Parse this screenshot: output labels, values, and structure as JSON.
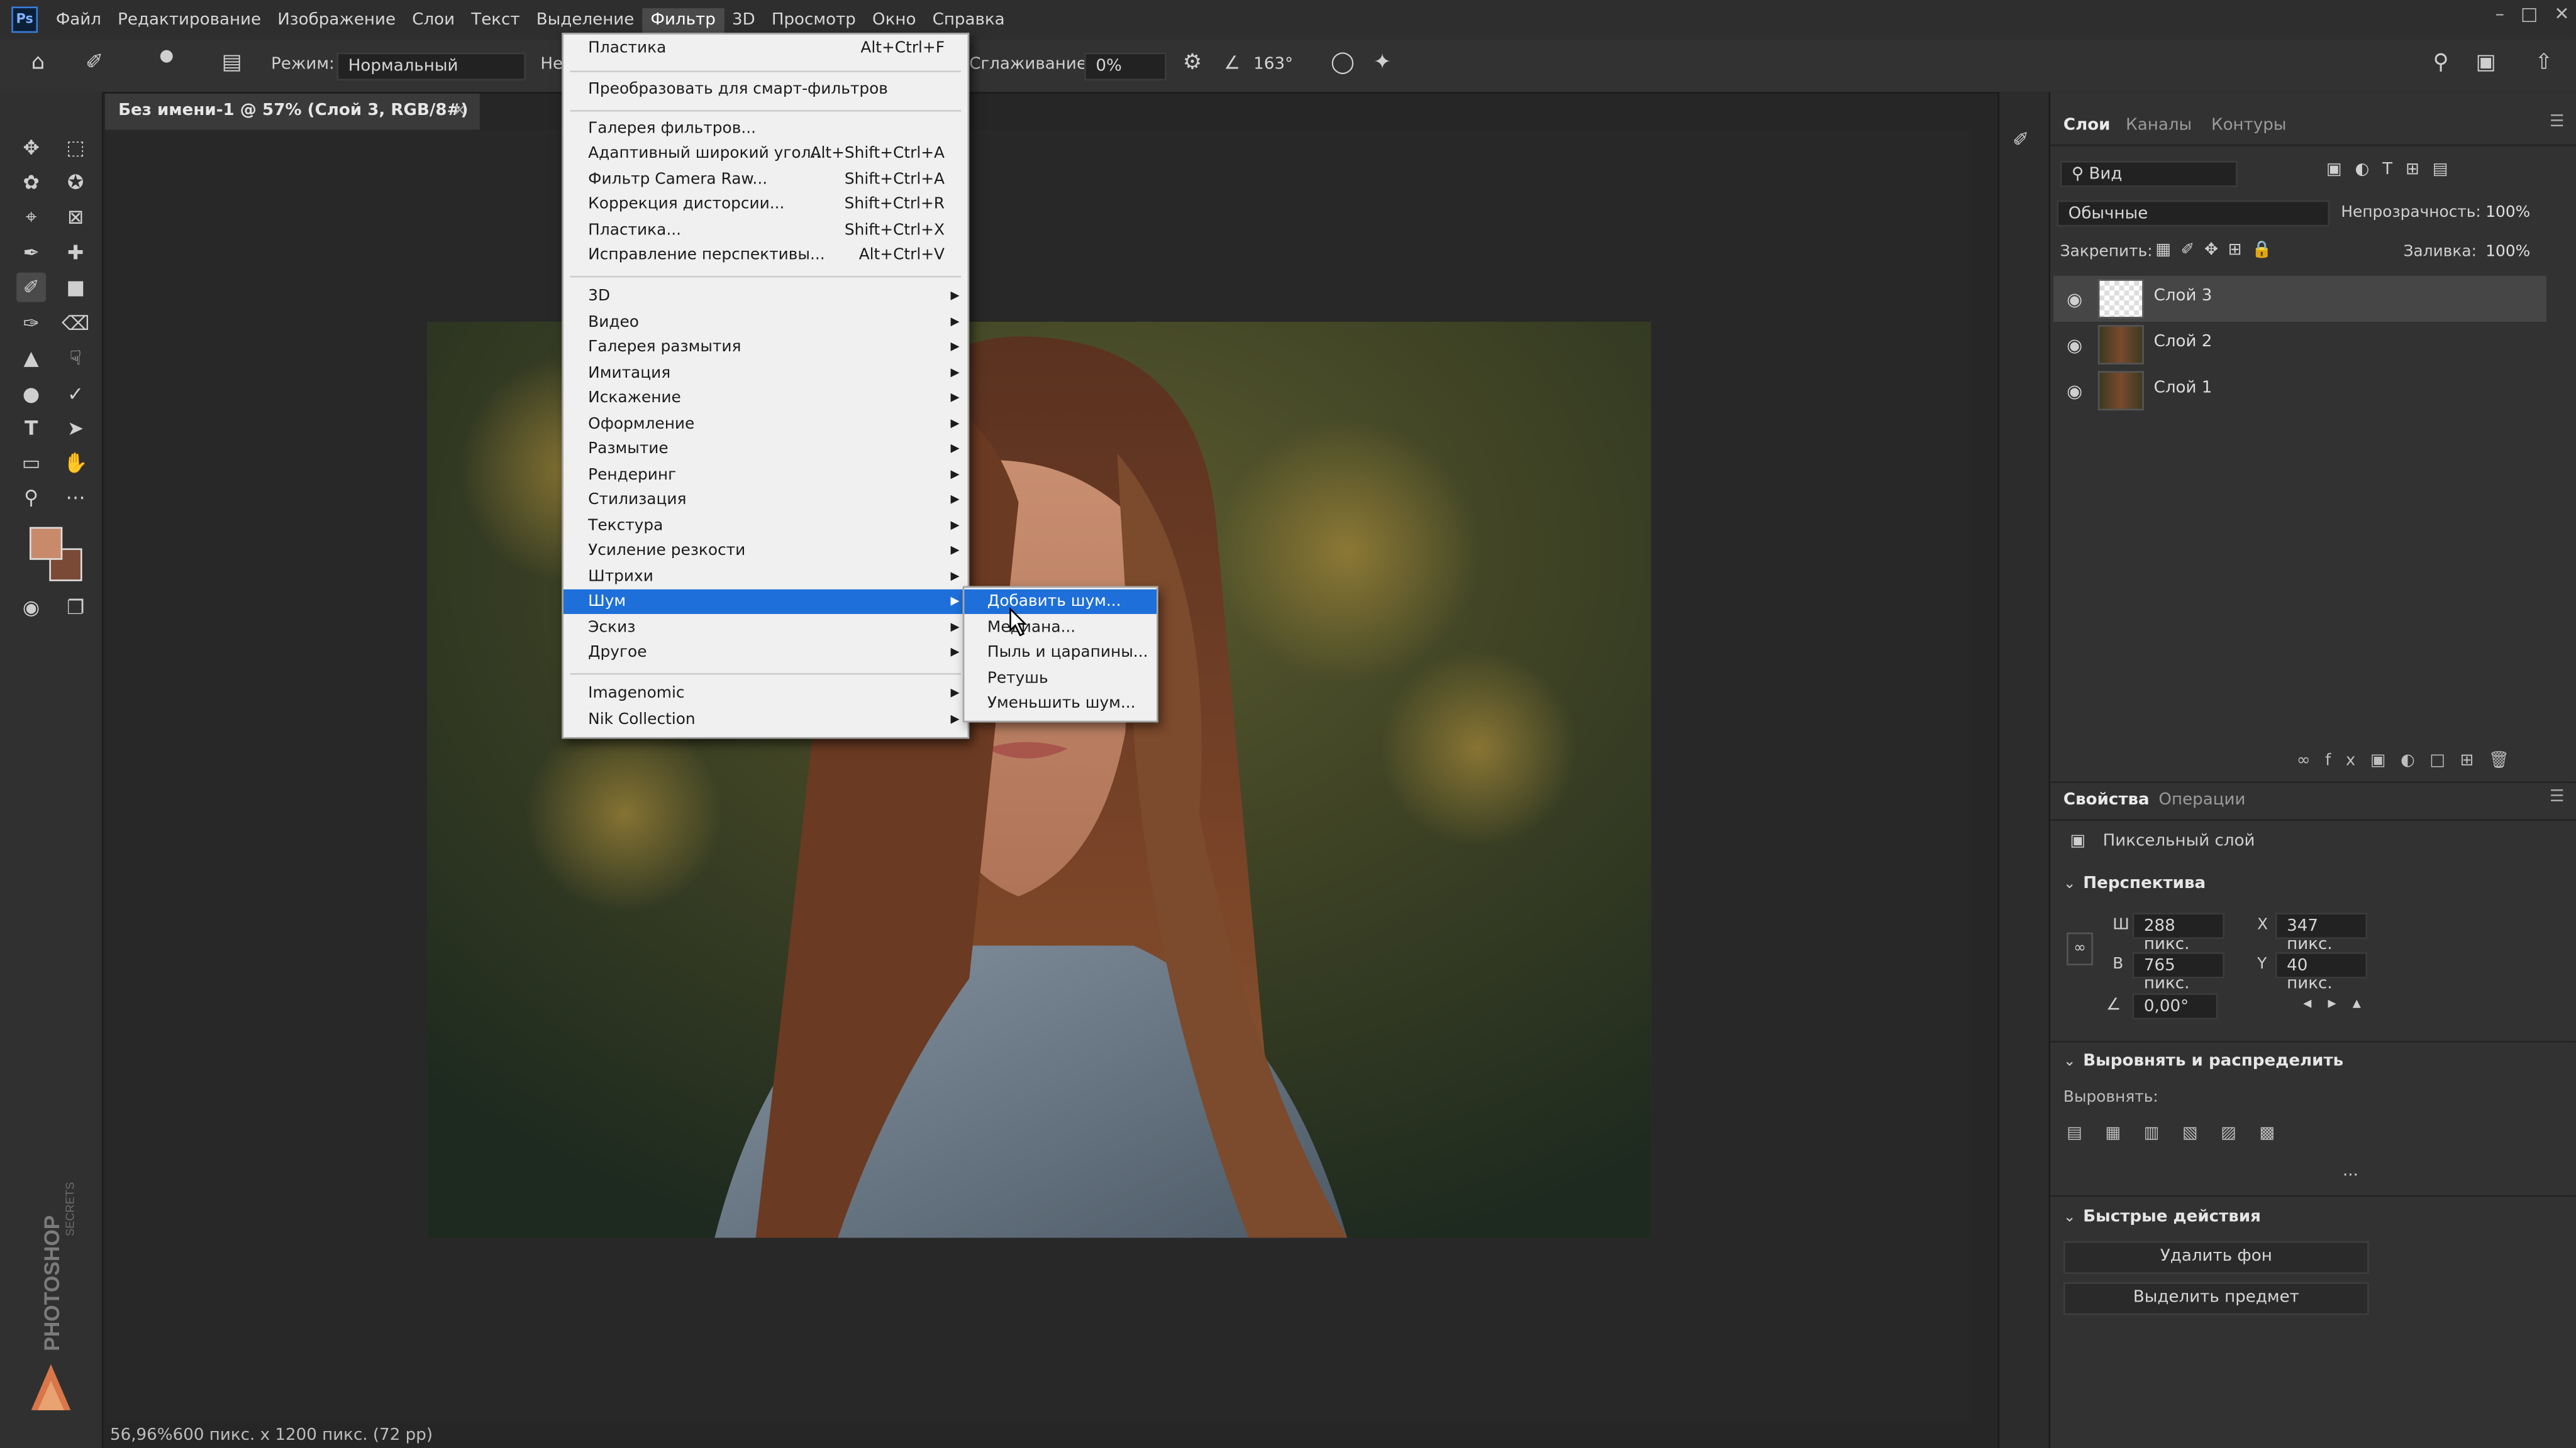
{
  "menubar": {
    "logo": "Ps",
    "items": [
      "Файл",
      "Редактирование",
      "Изображение",
      "Слои",
      "Текст",
      "Выделение",
      "Фильтр",
      "3D",
      "Просмотр",
      "Окно",
      "Справка"
    ],
    "active_index": 6
  },
  "options": {
    "mode_label": "Режим:",
    "mode_value": "Нормальный",
    "opacity_label_partial": "Не",
    "smoothing_label": "Сглаживание:",
    "smoothing_value": "0%",
    "angle_value": "163°"
  },
  "document": {
    "tab_title": "Без имени-1 @ 57% (Слой 3, RGB/8#) *",
    "status": "56,96%600 пикс. x 1200 пикс. (72 pp)",
    "watermark": "PHOTOSHOP SECRETS"
  },
  "filter_menu": {
    "top": [
      {
        "label": "Пластика",
        "shortcut": "Alt+Ctrl+F"
      },
      {
        "label": "Преобразовать для смарт-фильтров",
        "shortcut": ""
      }
    ],
    "group1": [
      {
        "label": "Галерея фильтров...",
        "shortcut": ""
      },
      {
        "label": "Адаптивный широкий угол...",
        "shortcut": "Alt+Shift+Ctrl+A"
      },
      {
        "label": "Фильтр Camera Raw...",
        "shortcut": "Shift+Ctrl+A"
      },
      {
        "label": "Коррекция дисторсии...",
        "shortcut": "Shift+Ctrl+R"
      },
      {
        "label": "Пластика...",
        "shortcut": "Shift+Ctrl+X"
      },
      {
        "label": "Исправление перспективы...",
        "shortcut": "Alt+Ctrl+V"
      }
    ],
    "submenus": [
      "3D",
      "Видео",
      "Галерея размытия",
      "Имитация",
      "Искажение",
      "Оформление",
      "Размытие",
      "Рендеринг",
      "Стилизация",
      "Текстура",
      "Усиление резкости",
      "Штрихи",
      "Шум",
      "Эскиз",
      "Другое"
    ],
    "highlighted": "Шум",
    "plugins": [
      "Imagenomic",
      "Nik Collection"
    ]
  },
  "noise_submenu": {
    "items": [
      "Добавить шум...",
      "Медиана...",
      "Пыль и царапины...",
      "Ретушь",
      "Уменьшить шум..."
    ],
    "highlighted_index": 0
  },
  "layers_panel": {
    "tabs": [
      "Слои",
      "Каналы",
      "Контуры"
    ],
    "search_placeholder": "Вид",
    "blend_mode": "Обычные",
    "opacity_label": "Непрозрачность:",
    "opacity_value": "100%",
    "lock_label": "Закрепить:",
    "fill_label": "Заливка:",
    "fill_value": "100%",
    "layers": [
      {
        "name": "Слой 3",
        "selected": true
      },
      {
        "name": "Слой 2",
        "selected": false
      },
      {
        "name": "Слой 1",
        "selected": false
      }
    ]
  },
  "properties_panel": {
    "tabs": [
      "Свойства",
      "Операции"
    ],
    "type_label": "Пиксельный слой",
    "transform_title": "Перспектива",
    "w_label": "Ш",
    "w_value": "288 пикс.",
    "h_label": "В",
    "h_value": "765 пикс.",
    "x_label": "X",
    "x_value": "347 пикс.",
    "y_label": "Y",
    "y_value": "40 пикс.",
    "angle_value": "0,00°",
    "align_title": "Выровнять и распределить",
    "align_label": "Выровнять:",
    "more": "...",
    "quick_title": "Быстрые действия",
    "remove_bg": "Удалить фон",
    "select_subject": "Выделить предмет"
  },
  "colors": {
    "menu_highlight": "#1e6fd9",
    "foreground_swatch": "#c98a6c",
    "background_swatch": "#7a4a36"
  }
}
